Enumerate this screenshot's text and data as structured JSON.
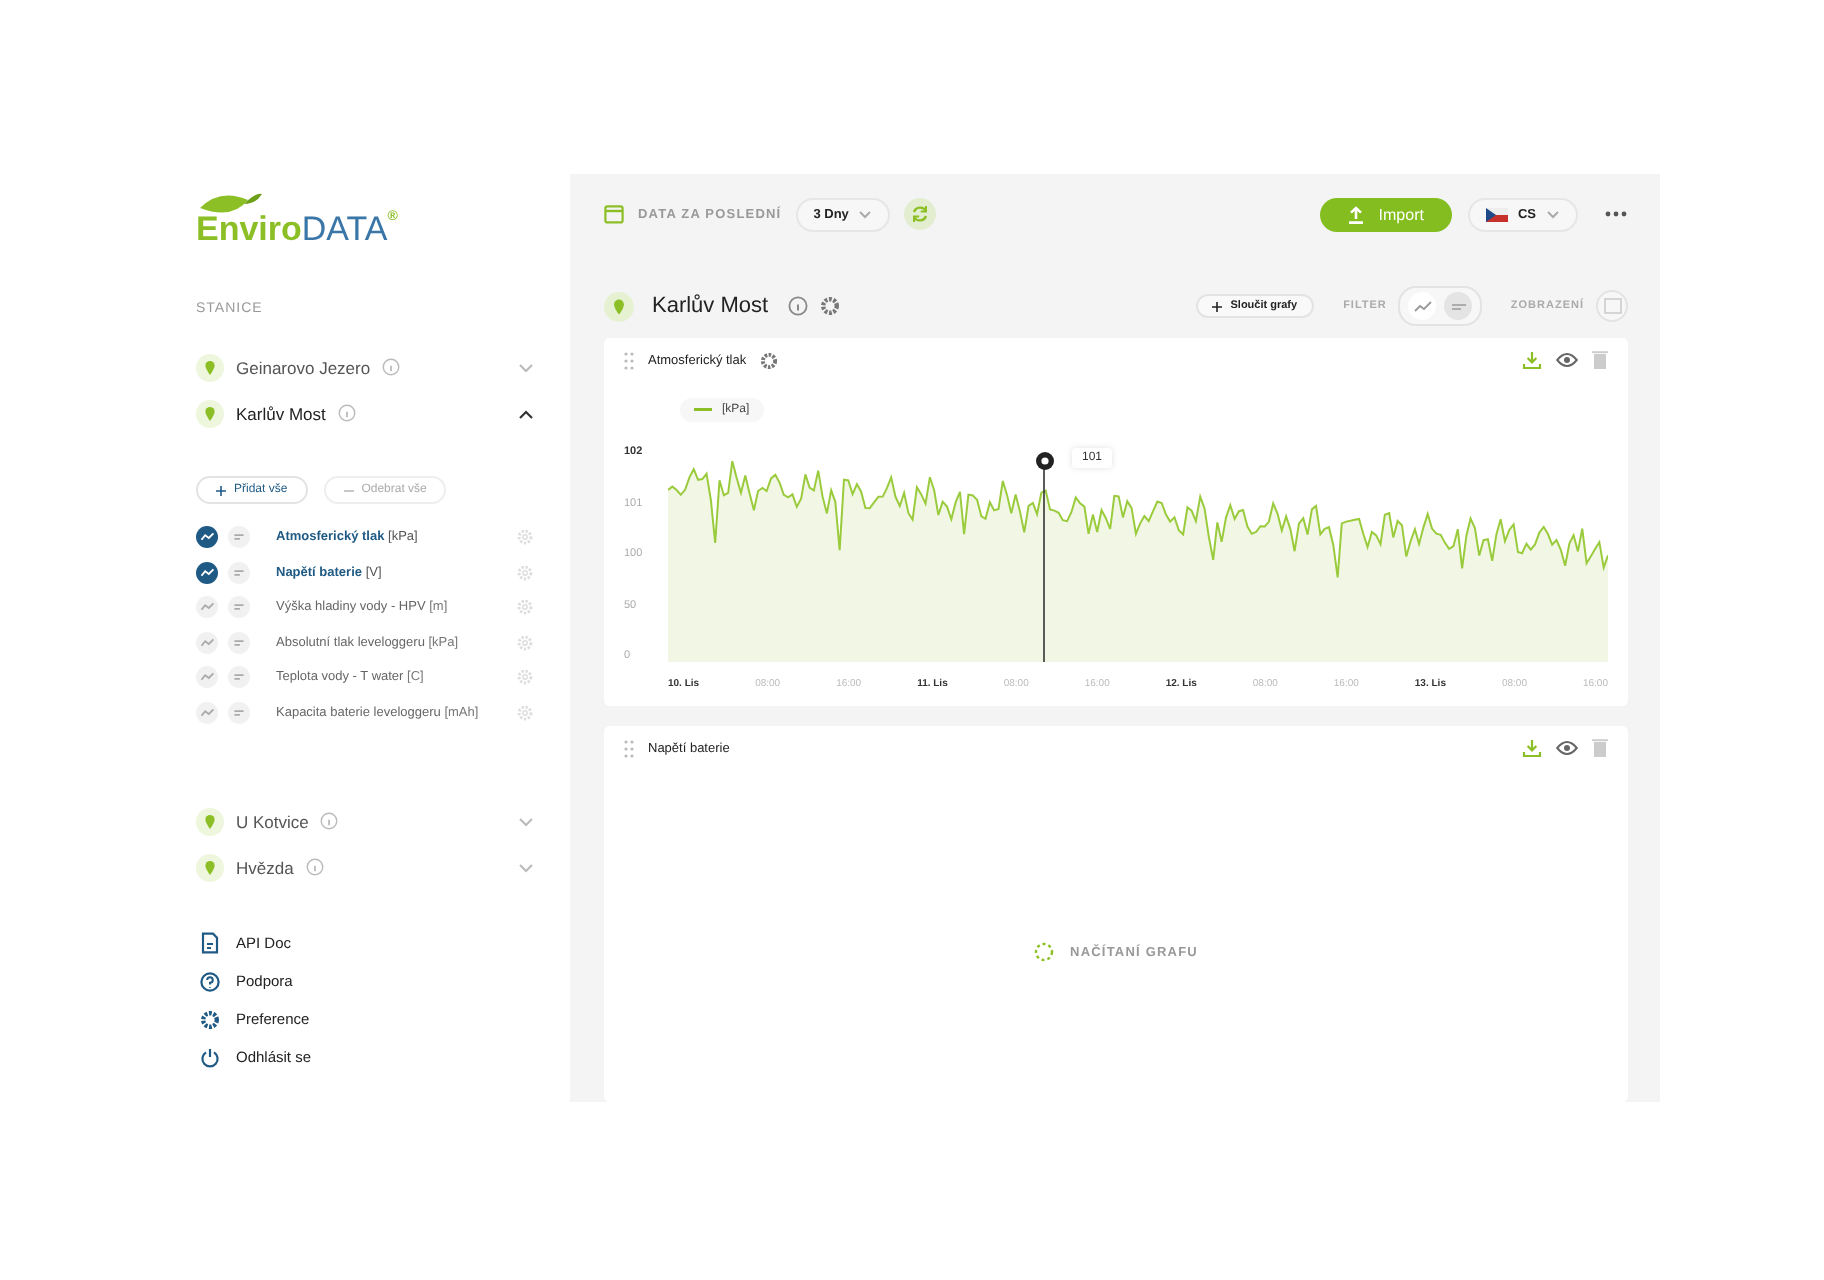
{
  "logo": {
    "part_1": "Enviro",
    "part_2": "DATA",
    "mark": "®"
  },
  "sidebar": {
    "section_title": "STANICE",
    "stations": [
      {
        "name": "Geinarovo Jezero",
        "expanded": false
      },
      {
        "name": "Karlův Most",
        "expanded": true,
        "add_all": "Přidat vše",
        "remove_all": "Odebrat vše",
        "parameters": [
          {
            "name": "Atmosferický tlak",
            "unit": "[kPa]",
            "selected": true
          },
          {
            "name": "Napětí baterie",
            "unit": "[V]",
            "selected": true
          },
          {
            "name": "Výška hladiny vody - HPV",
            "unit": "[m]",
            "selected": false
          },
          {
            "name": "Absolutní tlak leveloggeru",
            "unit": "[kPa]",
            "selected": false
          },
          {
            "name": "Teplota vody - T water",
            "unit": "[C]",
            "selected": false
          },
          {
            "name": "Kapacita baterie leveloggeru",
            "unit": "[mAh]",
            "selected": false
          }
        ]
      },
      {
        "name": "U Kotvice",
        "expanded": false
      },
      {
        "name": "Hvězda",
        "expanded": false
      }
    ],
    "links": [
      {
        "kind": "doc",
        "label": "API Doc"
      },
      {
        "kind": "help",
        "label": "Podpora"
      },
      {
        "kind": "settings",
        "label": "Preference"
      },
      {
        "kind": "logout",
        "label": "Odhlásit se"
      }
    ]
  },
  "toolbar": {
    "period_label": "DATA ZA POSLEDNÍ",
    "period_value": "3 Dny",
    "import_button": "Import",
    "language": "CS"
  },
  "station_header": {
    "title": "Karlův Most",
    "merge_button": "Sloučit grafy",
    "filter_label": "FILTER",
    "filter_options": [
      {
        "kind": "chart",
        "selected": true
      },
      {
        "kind": "table",
        "selected": false
      }
    ],
    "view_label": "ZOBRAZENÍ"
  },
  "charts": [
    {
      "title": "Atmosferický tlak",
      "kind": "loaded",
      "legend": "[kPa]",
      "y_labels": [
        "102",
        "101",
        "100",
        "50",
        "0"
      ],
      "x_labels": [
        {
          "text": "10. Lis",
          "kind": "day"
        },
        {
          "text": "08:00",
          "kind": "time"
        },
        {
          "text": "16:00",
          "kind": "time"
        },
        {
          "text": "11. Lis",
          "kind": "day"
        },
        {
          "text": "08:00",
          "kind": "time"
        },
        {
          "text": "16:00",
          "kind": "time"
        },
        {
          "text": "12. Lis",
          "kind": "day"
        },
        {
          "text": "08:00",
          "kind": "time"
        },
        {
          "text": "16:00",
          "kind": "time"
        },
        {
          "text": "13. Lis",
          "kind": "day"
        },
        {
          "text": "08:00",
          "kind": "time"
        },
        {
          "text": "16:00",
          "kind": "time"
        }
      ],
      "tooltip": "101"
    },
    {
      "title": "Napětí baterie",
      "kind": "loading",
      "loading_text": "NAČÍTANÍ GRAFU"
    }
  ]
}
